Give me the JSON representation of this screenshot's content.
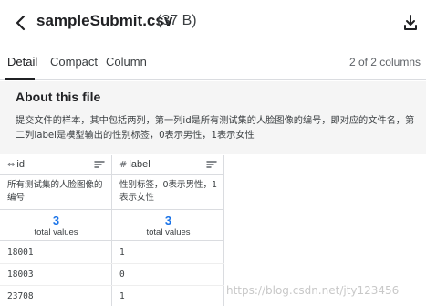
{
  "header": {
    "filename": "sampleSubmit.csv",
    "filesize": "(37 B)",
    "back_icon": "chevron-left-icon",
    "download_icon": "download-icon"
  },
  "tabs": [
    {
      "label": "Detail",
      "active": true
    },
    {
      "label": "Compact",
      "active": false
    },
    {
      "label": "Column",
      "active": false
    }
  ],
  "column_count": "2 of 2 columns",
  "about": {
    "title": "About this file",
    "text": "提交文件的样本，其中包括两列，第一列id是所有测试集的人脸图像的编号，即对应的文件名，第二列label是模型输出的性别标签，0表示男性，1表示女性"
  },
  "columns": [
    {
      "name": "id",
      "type_icon": "⇔",
      "description": "所有测试集的人脸图像的编号",
      "stat_value": "3",
      "stat_label": "total values",
      "values": [
        "18001",
        "18003",
        "23708"
      ]
    },
    {
      "name": "label",
      "type_icon": "#",
      "description": "性别标签，0表示男性，1表示女性",
      "stat_value": "3",
      "stat_label": "total values",
      "values": [
        "1",
        "0",
        "1"
      ]
    }
  ],
  "watermark": "https://blog.csdn.net/jty123456"
}
